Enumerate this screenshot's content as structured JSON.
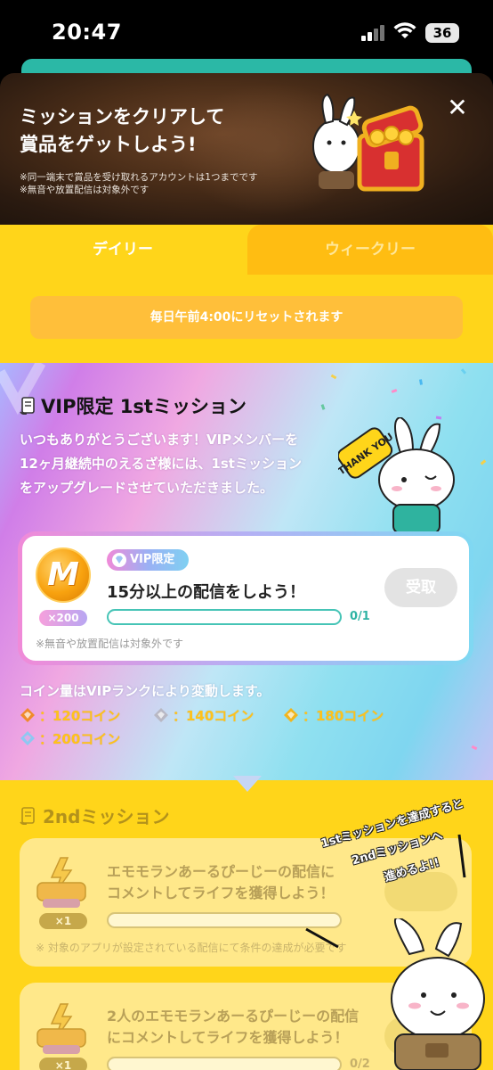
{
  "status_bar": {
    "time": "20:47",
    "battery": "36"
  },
  "header": {
    "title": "ミッションをクリアして\n賞品をゲットしよう!",
    "note_1": "※同一端末で賞品を受け取れるアカウントは1つまでです",
    "note_2": "※無音や放置配信は対象外です",
    "close_icon": "close-icon"
  },
  "tabs": [
    {
      "label": "デイリー",
      "active": true
    },
    {
      "label": "ウィークリー",
      "active": false
    }
  ],
  "reset_notice": "毎日午前4:00にリセットされます",
  "vip_section": {
    "heading": "VIP限定 1stミッション",
    "description": "いつもありがとうございます！VIPメンバーを12ヶ月継続中のえるざ様には、1stミッションをアップグレードさせていただきました。",
    "mission": {
      "badge": "VIP限定",
      "title": "15分以上の配信をしよう！",
      "reward_qty": "×200",
      "progress_text": "0/1",
      "progress_value": 0,
      "claim_label": "受取",
      "note": "※無音や放置配信は対象外です"
    },
    "rank_title": "コイン量はVIPランクにより変動します。",
    "ranks": [
      {
        "label": "：120コイン",
        "color": "#f08a2a"
      },
      {
        "label": "：140コイン",
        "color": "#b8b8c4"
      },
      {
        "label": "：180コイン",
        "color": "#f2b51c"
      },
      {
        "label": "：200コイン",
        "color": "#8ec8f2"
      }
    ],
    "mascot_sign": "THANK YOU"
  },
  "second_section": {
    "heading": "2ndミッション",
    "missions": [
      {
        "title": "エモモランあーるぴーじーの配信に\nコメントしてライフを獲得しよう！",
        "reward_qty": "×1",
        "progress_text": "",
        "note": "※ 対象のアプリが設定されている配信にて条件の達成が必要です"
      },
      {
        "title": "2人のエモモランあーるぴーじーの配信\nにコメントしてライフを獲得しよう！",
        "reward_qty": "×1",
        "progress_text": "0/2",
        "note": ""
      }
    ],
    "speech_lines": [
      "1stミッションを達成すると",
      "2ndミッションへ",
      "進めるよ!!"
    ]
  },
  "colors": {
    "yellow": "#ffd51a",
    "tab_inactive": "#ffbd12",
    "teal": "#46c4b6"
  }
}
